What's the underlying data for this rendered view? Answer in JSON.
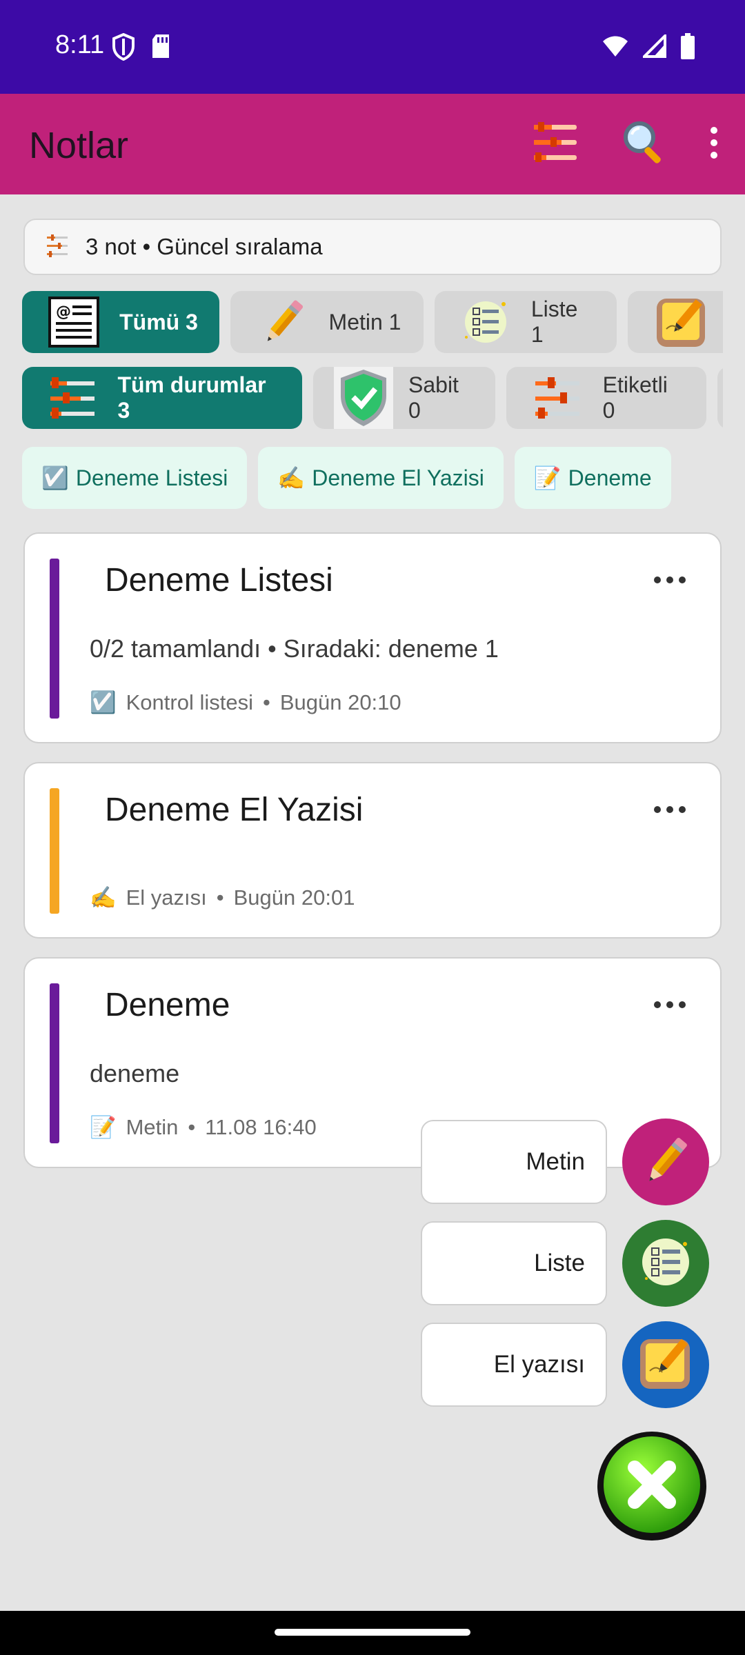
{
  "status_bar": {
    "time": "8:11"
  },
  "app_bar": {
    "title": "Notlar",
    "icons": [
      "sort-icon",
      "search-icon",
      "more-vert-icon"
    ]
  },
  "summary": {
    "text": "3 not • Güncel sıralama"
  },
  "type_filters": [
    {
      "label": "Tümü 3",
      "icon": "all-notes-icon",
      "active": true
    },
    {
      "label": "Metin 1",
      "icon": "pencil-icon",
      "active": false
    },
    {
      "label": "Liste 1",
      "icon": "checklist-icon",
      "active": false
    },
    {
      "label": "",
      "icon": "handwriting-icon",
      "active": false
    }
  ],
  "status_filters": [
    {
      "label": "Tüm durumlar 3",
      "icon": "sliders-icon",
      "active": true
    },
    {
      "label": "Sabit 0",
      "icon": "shield-check-icon",
      "active": false
    },
    {
      "label": "Etiketli 0",
      "icon": "sliders-icon",
      "active": false
    }
  ],
  "quick_notes": [
    {
      "emoji": "☑️",
      "label": "Deneme Listesi"
    },
    {
      "emoji": "✍️",
      "label": "Deneme El Yazisi"
    },
    {
      "emoji": "📝",
      "label": "Deneme"
    }
  ],
  "notes": [
    {
      "title": "Deneme Listesi",
      "body": "0/2 tamamlandı • Sıradaki: deneme 1",
      "type_emoji": "☑️",
      "type_label": "Kontrol listesi",
      "date": "Bugün 20:10",
      "accent": "#6a1b9a"
    },
    {
      "title": "Deneme El Yazisi",
      "body": "",
      "type_emoji": "✍️",
      "type_label": "El yazısı",
      "date": "Bugün 20:01",
      "accent": "#f5a623"
    },
    {
      "title": "Deneme",
      "body": "deneme",
      "type_emoji": "📝",
      "type_label": "Metin",
      "date": "11.08 16:40",
      "accent": "#6a1b9a"
    }
  ],
  "meta_separator": "•",
  "fab_menu": [
    {
      "label": "Metin",
      "icon": "pencil-icon",
      "color": "#c0217a"
    },
    {
      "label": "Liste",
      "icon": "checklist-icon",
      "color": "#2e7d32"
    },
    {
      "label": "El yazısı",
      "icon": "handwriting-icon",
      "color": "#1565c0"
    }
  ],
  "colors": {
    "status_bar": "#3d0aa6",
    "app_bar": "#c0217a",
    "active_chip": "#117a70",
    "quick_chip_bg": "#e5f9f1",
    "background": "#e4e4e4"
  }
}
